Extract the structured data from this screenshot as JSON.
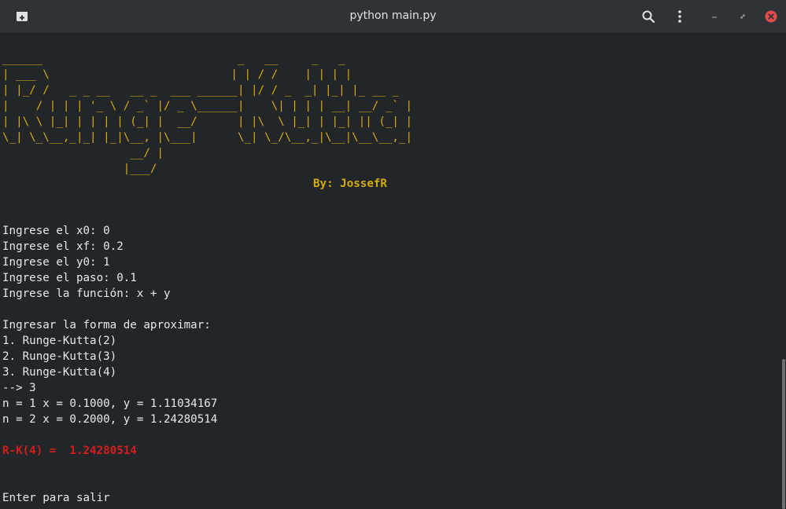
{
  "window": {
    "title": "python main.py",
    "colors": {
      "titlebar": "#2f3338",
      "terminal_bg": "#232629",
      "banner": "#d4aa0f",
      "result": "#d41c1c",
      "close": "#e44b4b"
    },
    "icons": [
      "new-tab-icon",
      "search-icon",
      "menu-kebab-icon",
      "minimize-icon",
      "maximize-icon",
      "close-icon"
    ]
  },
  "terminal": {
    "banner": [
      "______                             _   __     _   _",
      "| ___ \\                           | | / /    | | | |",
      "| |_/ /   _ _ __   __ _  ___ ______| |/ / _  _| |_| |_ __ _",
      "|    / | | | '_ \\ / _` |/ _ \\______|    \\| | | | __| __/ _` |",
      "| |\\ \\ |_| | | | | (_| |  __/      | |\\  \\ |_| | |_| || (_| |",
      "\\_| \\_\\__,_|_| |_|\\__, |\\___|      \\_| \\_/\\__,_|\\__|\\__\\__,_|",
      "                   __/ |",
      "                  |___/"
    ],
    "byline": "By: JossefR",
    "inputs": [
      "Ingrese el x0: 0",
      "Ingrese el xf: 0.2",
      "Ingrese el y0: 1",
      "Ingrese el paso: 0.1",
      "Ingrese la función: x + y"
    ],
    "menu_prompt": "Ingresar la forma de aproximar:",
    "menu_options": [
      "1. Runge-Kutta(2)",
      "2. Runge-Kutta(3)",
      "3. Runge-Kutta(4)"
    ],
    "choice": "--> 3",
    "iterations": [
      "n = 1 x = 0.1000, y = 1.11034167",
      "n = 2 x = 0.2000, y = 1.24280514"
    ],
    "result": "R-K(4) =  1.24280514",
    "exit_prompt": "Enter para salir"
  }
}
